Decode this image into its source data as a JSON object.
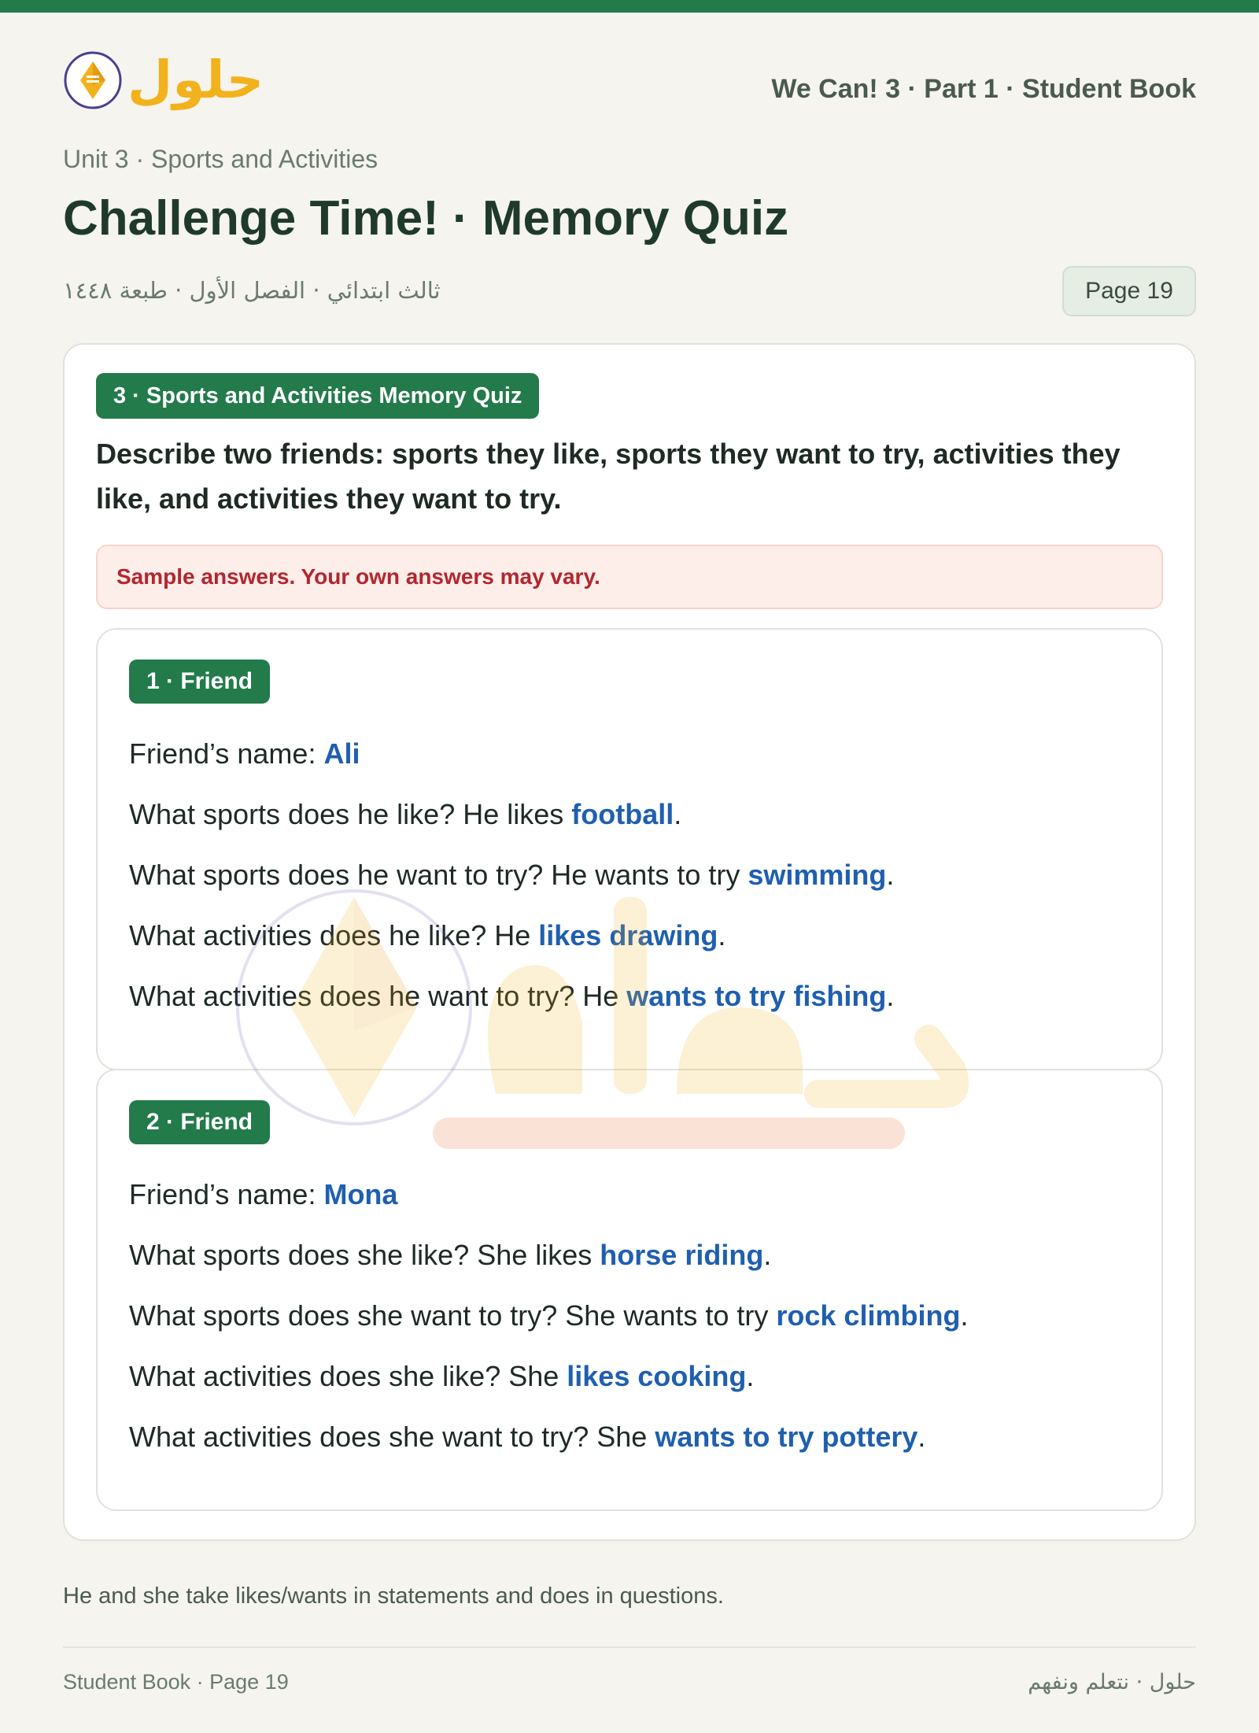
{
  "header": {
    "logo_text": "حلول",
    "book_title": "We Can! 3 · Part 1 · Student Book"
  },
  "unit": "Unit 3 · Sports and Activities",
  "title": "Challenge Time! · Memory Quiz",
  "arabic_subtitle": "ثالث ابتدائي · الفصل الأول · طبعة ١٤٤٨",
  "page_badge": "Page 19",
  "section": {
    "label": "3 · Sports and Activities Memory Quiz",
    "instruction": "Describe two friends: sports they like, sports they want to try, activities they like, and activities they want to try.",
    "note": "Sample answers. Your own answers may vary."
  },
  "friends": [
    {
      "tag": "1 · Friend",
      "lines": [
        {
          "q": "Friend’s name: ",
          "a": "Ali",
          "end": ""
        },
        {
          "q": "What sports does he like? He likes ",
          "a": "football",
          "end": "."
        },
        {
          "q": "What sports does he want to try? He wants to try ",
          "a": "swimming",
          "end": "."
        },
        {
          "q": "What activities does he like? He ",
          "a": "likes drawing",
          "end": "."
        },
        {
          "q": "What activities does he want to try? He ",
          "a": "wants to try fishing",
          "end": "."
        }
      ]
    },
    {
      "tag": "2 · Friend",
      "lines": [
        {
          "q": "Friend’s name: ",
          "a": "Mona",
          "end": ""
        },
        {
          "q": "What sports does she like? She likes ",
          "a": "horse riding",
          "end": "."
        },
        {
          "q": "What sports does she want to try? She wants to try ",
          "a": "rock climbing",
          "end": "."
        },
        {
          "q": "What activities does she like? She ",
          "a": "likes cooking",
          "end": "."
        },
        {
          "q": "What activities does she want to try? She ",
          "a": "wants to try pottery",
          "end": "."
        }
      ]
    }
  ],
  "grammar_note": "He and she take likes/wants in statements and does in questions.",
  "footer": {
    "left": "Student Book · Page 19",
    "right": "حلول · نتعلم ونفهم"
  },
  "colors": {
    "accent_green": "#237a4b",
    "answer_blue": "#1f5fb0",
    "note_red": "#b3262d",
    "logo_yellow": "#f2b21d"
  },
  "icons": [
    "logo-emblem-icon",
    "watermark-logo-icon"
  ]
}
